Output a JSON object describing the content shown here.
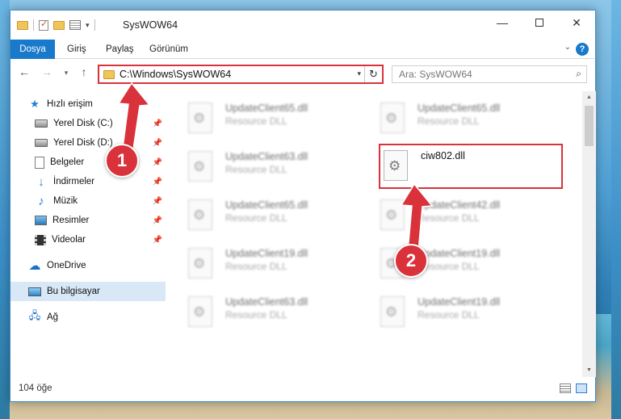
{
  "window": {
    "title": "SysWOW64"
  },
  "ribbon": {
    "tabs": [
      "Dosya",
      "Giriş",
      "Paylaş",
      "Görünüm"
    ]
  },
  "address": {
    "path": "C:\\Windows\\SysWOW64"
  },
  "search": {
    "placeholder": "Ara: SysWOW64"
  },
  "sidebar": {
    "items": [
      {
        "label": "Hızlı erişim",
        "icon": "star-icon"
      },
      {
        "label": "Yerel Disk (C:)",
        "icon": "disk-icon",
        "pinned": true
      },
      {
        "label": "Yerel Disk (D:)",
        "icon": "disk-icon",
        "pinned": true
      },
      {
        "label": "Belgeler",
        "icon": "documents-icon",
        "pinned": true
      },
      {
        "label": "İndirmeler",
        "icon": "download-icon",
        "pinned": true
      },
      {
        "label": "Müzik",
        "icon": "music-icon",
        "pinned": true
      },
      {
        "label": "Resimler",
        "icon": "pictures-icon",
        "pinned": true
      },
      {
        "label": "Videolar",
        "icon": "videos-icon",
        "pinned": true
      },
      {
        "label": "OneDrive",
        "icon": "cloud-icon"
      },
      {
        "label": "Bu bilgisayar",
        "icon": "computer-icon",
        "selected": true
      },
      {
        "label": "Ağ",
        "icon": "network-icon"
      }
    ]
  },
  "files": {
    "left_column": [
      {
        "name": "UpdateClient65.dll",
        "type": "Resource DLL"
      },
      {
        "name": "UpdateClient63.dll",
        "type": "Resource DLL"
      },
      {
        "name": "UpdateClient65.dll",
        "type": "Resource DLL"
      },
      {
        "name": "UpdateClient19.dll",
        "type": "Resource DLL"
      },
      {
        "name": "UpdateClient63.dll",
        "type": "Resource DLL"
      }
    ],
    "right_column": [
      {
        "name": "UpdateClient65.dll",
        "type": "Resource DLL"
      },
      {
        "name": "ciw802.dll",
        "type": ""
      },
      {
        "name": "UpdateClient42.dll",
        "type": "Resource DLL"
      },
      {
        "name": "UpdateClient19.dll",
        "type": "Resource DLL"
      },
      {
        "name": "UpdateClient19.dll",
        "type": "Resource DLL"
      }
    ]
  },
  "status": {
    "item_count": "104 öğe"
  },
  "annotations": {
    "marker_1": "1",
    "marker_2": "2",
    "highlight_color": "#d9323b"
  }
}
